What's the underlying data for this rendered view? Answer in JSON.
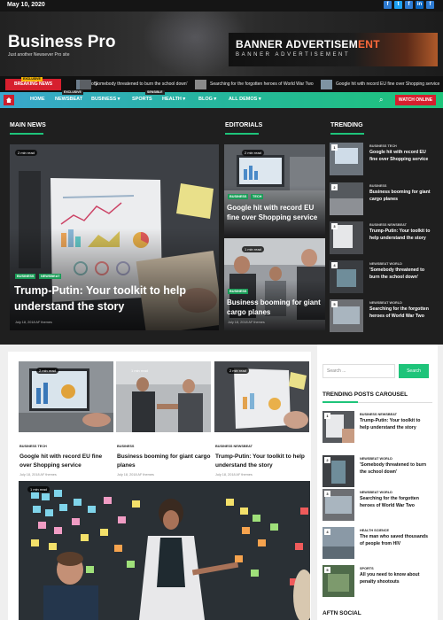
{
  "topbar": {
    "date": "May 10, 2020",
    "social": [
      "f",
      "t",
      "f",
      "in",
      "f"
    ]
  },
  "header": {
    "site_title": "Business Pro",
    "tagline": "Just another Newsever Pro site",
    "banner_main": "BANNER ADVERTISEM",
    "banner_accent": "ENT",
    "banner_sub": "BANNER ADVERTISEMENT"
  },
  "breaking": {
    "exclusive": "EXCLUSIVE",
    "label": "BREAKING NEWS",
    "items": [
      "ory",
      "'Somebody threatened to burn the school down'",
      "Searching for the forgotten heroes of World War Two",
      "Google hit with record EU fine over Shopping service"
    ]
  },
  "nav": {
    "home": "HOME",
    "items": [
      "NEWSBEAT",
      "BUSINESS",
      "SPORTS",
      "HEALTH",
      "BLOG",
      "ALL DEMOS"
    ],
    "badge_exclusive": "EXCLUSIVE",
    "badge_sensible": "SENSIBLE",
    "watch": "WATCH ONLINE"
  },
  "main_news": {
    "title": "MAIN NEWS",
    "read": "2 min read",
    "cats": [
      "BUSINESS",
      "NEWSBEAT"
    ],
    "headline": "Trump-Putin: Your toolkit to help understand the story",
    "meta": "July 18, 2018  AF themes"
  },
  "editorials": {
    "title": "EDITORIALS",
    "items": [
      {
        "read": "2 min read",
        "cats": [
          "BUSINESS",
          "TECH"
        ],
        "title": "Google hit with record EU fine over Shopping service",
        "meta": "July 18, 2018  AF themes"
      },
      {
        "read": "1 min read",
        "cats": [
          "BUSINESS"
        ],
        "title": "Business booming for giant cargo planes",
        "meta": "July 18, 2018  AF themes"
      }
    ]
  },
  "trending": {
    "title": "TRENDING",
    "items": [
      {
        "n": "1",
        "cats": "BUSINESS   TECH",
        "text": "Google hit with record EU fine over Shopping service"
      },
      {
        "n": "2",
        "cats": "BUSINESS",
        "text": "Business booming for giant cargo planes"
      },
      {
        "n": "3",
        "cats": "BUSINESS   NEWSBEAT",
        "text": "Trump-Putin: Your toolkit to help understand the story"
      },
      {
        "n": "4",
        "cats": "NEWSBEAT   WORLD",
        "text": "'Somebody threatened to burn the school down'"
      },
      {
        "n": "5",
        "cats": "NEWSBEAT   WORLD",
        "text": "Searching for the forgotten heroes of World War Two"
      }
    ]
  },
  "grid": [
    {
      "read": "2 min read",
      "cats": "BUSINESS   TECH",
      "title": "Google hit with record EU fine over Shopping service",
      "meta": "July 18, 2018  AF themes"
    },
    {
      "read": "1 min read",
      "cats": "BUSINESS",
      "title": "Business booming for giant cargo planes",
      "meta": "July 18, 2018  AF themes"
    },
    {
      "read": "2 min read",
      "cats": "BUSINESS   NEWSBEAT",
      "title": "Trump-Putin: Your toolkit to help understand the story",
      "meta": "July 18, 2018  AF themes"
    }
  ],
  "big_read": "1 min read",
  "sidebar": {
    "search_placeholder": "Search ...",
    "search_btn": "Search",
    "carousel_title": "TRENDING POSTS CAROUSEL",
    "items": [
      {
        "n": "1",
        "cats": "BUSINESS   NEWSBEAT",
        "text": "Trump-Putin: Your toolkit to help understand the story"
      },
      {
        "n": "2",
        "cats": "NEWSBEAT   WORLD",
        "text": "'Somebody threatened to burn the school down'"
      },
      {
        "n": "3",
        "cats": "NEWSBEAT   WORLD",
        "text": "Searching for the forgotten heroes of World War Two"
      },
      {
        "n": "4",
        "cats": "HEALTH   SCIENCE",
        "text": "The man who saved thousands of people from HIV"
      },
      {
        "n": "5",
        "cats": "SPORTS",
        "text": "All you need to know about penalty shootouts"
      }
    ],
    "social_title": "AFTN SOCIAL"
  }
}
